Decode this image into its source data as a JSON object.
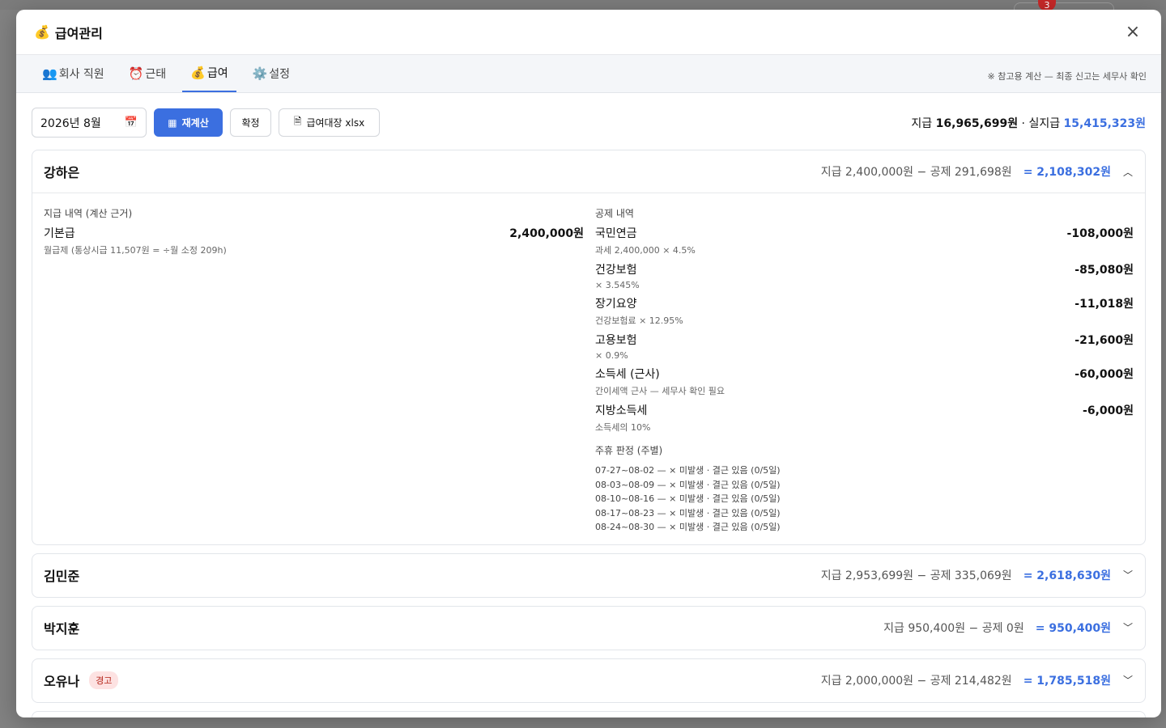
{
  "background": {
    "badge_count": "3"
  },
  "modal": {
    "icon": "money-bag-icon",
    "title": "급여관리",
    "close_icon": "×"
  },
  "tabs": [
    {
      "icon": "👥",
      "label": "회사 직원"
    },
    {
      "icon": "⏰",
      "label": "근태"
    },
    {
      "icon": "💰",
      "label": "급여",
      "active": true
    },
    {
      "icon": "⚙️",
      "label": "설정"
    }
  ],
  "tabs_note": "※ 참고용 계산 — 최종 신고는 세무사 확인",
  "toolbar": {
    "month_value": "2026년 8월",
    "recalc_label": "재계산",
    "confirm_label": "확정",
    "xlsx_label": "급여대장 xlsx",
    "totals": {
      "pay_label": "지급",
      "pay_value": "16,965,699원",
      "sep": " · ",
      "net_label": "실지급",
      "net_value": "15,415,323원"
    }
  },
  "employees": [
    {
      "name": "강하은",
      "pay_summary": "지급 2,400,000원 − 공제 291,698원",
      "net": "= 2,108,302원",
      "expanded": true,
      "pay_section_title": "지급 내역 (계산 근거)",
      "pay_items": [
        {
          "label": "기본급",
          "sub": "월급제 (통상시급 11,507원 = ÷월 소정 209h)",
          "amount": "2,400,000원"
        }
      ],
      "deduction_section_title": "공제 내역",
      "deductions": [
        {
          "label": "국민연금",
          "sub": "과세 2,400,000 × 4.5%",
          "amount": "-108,000원"
        },
        {
          "label": "건강보험",
          "sub": "× 3.545%",
          "amount": "-85,080원"
        },
        {
          "label": "장기요양",
          "sub": "건강보험료 × 12.95%",
          "amount": "-11,018원"
        },
        {
          "label": "고용보험",
          "sub": "× 0.9%",
          "amount": "-21,600원"
        },
        {
          "label": "소득세 (근사)",
          "sub": "간이세액 근사 — 세무사 확인 필요",
          "amount": "-60,000원"
        },
        {
          "label": "지방소득세",
          "sub": "소득세의 10%",
          "amount": "-6,000원"
        }
      ],
      "weekly_title": "주휴 판정 (주별)",
      "weekly": [
        "07-27~08-02 — × 미발생 · 결근 있음 (0/5일)",
        "08-03~08-09 — × 미발생 · 결근 있음 (0/5일)",
        "08-10~08-16 — × 미발생 · 결근 있음 (0/5일)",
        "08-17~08-23 — × 미발생 · 결근 있음 (0/5일)",
        "08-24~08-30 — × 미발생 · 결근 있음 (0/5일)"
      ]
    },
    {
      "name": "김민준",
      "pay_summary": "지급 2,953,699원 − 공제 335,069원",
      "net": "= 2,618,630원",
      "expanded": false
    },
    {
      "name": "박지훈",
      "pay_summary": "지급 950,400원 − 공제 0원",
      "net": "= 950,400원",
      "expanded": false
    },
    {
      "name": "오유나",
      "badge": "경고",
      "pay_summary": "지급 2,000,000원 − 공제 214,482원",
      "net": "= 1,785,518원",
      "expanded": false
    }
  ]
}
